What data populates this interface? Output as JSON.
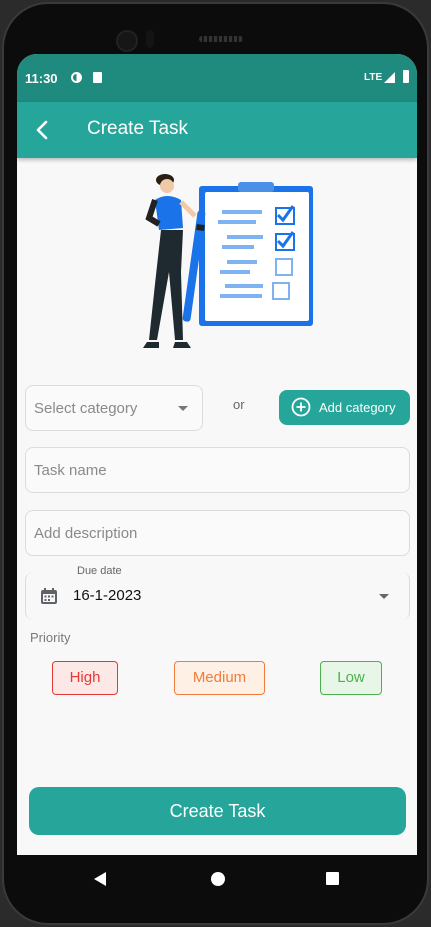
{
  "status_bar": {
    "time": "11:30",
    "network": "LTE"
  },
  "app_bar": {
    "title": "Create Task"
  },
  "category": {
    "placeholder": "Select category",
    "or_text": "or",
    "add_label": "Add category"
  },
  "form": {
    "task_name_placeholder": "Task name",
    "description_placeholder": "Add description",
    "due_date_label": "Due date",
    "due_date_value": "16-1-2023"
  },
  "priority": {
    "label": "Priority",
    "options": [
      "High",
      "Medium",
      "Low"
    ]
  },
  "submit_label": "Create Task",
  "colors": {
    "primary": "#26a69a",
    "status_bar": "#1f8a7e",
    "high": "#e53935",
    "medium": "#f07c3c",
    "low": "#4caf50"
  }
}
